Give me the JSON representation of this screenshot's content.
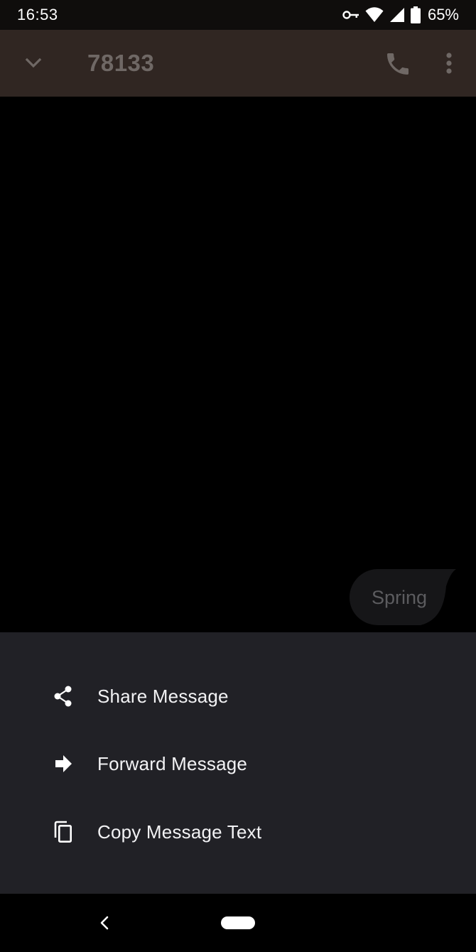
{
  "status_bar": {
    "time": "16:53",
    "battery": "65%",
    "icons": [
      "vpn-key-icon",
      "wifi-icon",
      "cell-signal-icon",
      "battery-icon"
    ]
  },
  "toolbar": {
    "title": "78133",
    "icons": [
      "chevron-down-icon",
      "phone-icon",
      "more-vert-icon"
    ]
  },
  "conversation": {
    "messages": [
      {
        "text": "Spring",
        "direction": "incoming"
      }
    ]
  },
  "sheet": {
    "items": [
      {
        "label": "Share Message",
        "icon": "share-icon"
      },
      {
        "label": "Forward Message",
        "icon": "forward-icon"
      },
      {
        "label": "Copy Message Text",
        "icon": "copy-icon"
      }
    ]
  },
  "navbar": {
    "icons": [
      "back-icon",
      "home-pill"
    ]
  },
  "colors": {
    "toolbar_bg": "#302622",
    "sheet_bg": "#212126",
    "bubble_bg": "#161618",
    "screen_bg": "#000000"
  }
}
